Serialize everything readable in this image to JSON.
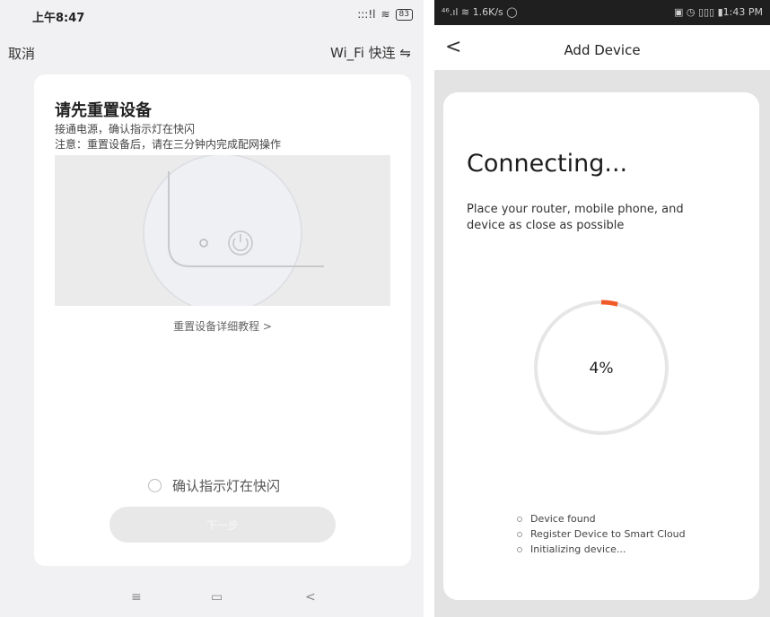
{
  "left": {
    "status": {
      "time": "上午8:47",
      "signal": ":::!l",
      "wifi": "≋",
      "battery": "83"
    },
    "header": {
      "cancel": "取消",
      "wifi_quick": "Wi_Fi 快连 ⇋"
    },
    "card": {
      "title": "请先重置设备",
      "line1": "接通电源，确认指示灯在快闪",
      "line2": "注意：重置设备后，请在三分钟内完成配网操作",
      "tutorial": "重置设备详细教程 >",
      "confirm": "确认指示灯在快闪",
      "next": "下一步"
    },
    "nav": {
      "menu": "≡",
      "home": "▭",
      "back": "<"
    }
  },
  "right": {
    "status": {
      "left": "⁴⁶.ıl ≋  1.6K/s  ◯",
      "right": "▣ ◷ ▯▯▯ ▮1:43 PM"
    },
    "appbar": {
      "back": "<",
      "title": "Add Device"
    },
    "card": {
      "title": "Connecting...",
      "hint_line1": "Place your router, mobile phone, and",
      "hint_line2": "device as close as possible",
      "progress_text": "4%",
      "progress": 0.04,
      "steps": [
        "Device found",
        "Register Device to Smart Cloud",
        "Initializing device..."
      ]
    }
  },
  "colors": {
    "progress_accent": "#f05a28",
    "ring_track": "#e6e6e6"
  }
}
